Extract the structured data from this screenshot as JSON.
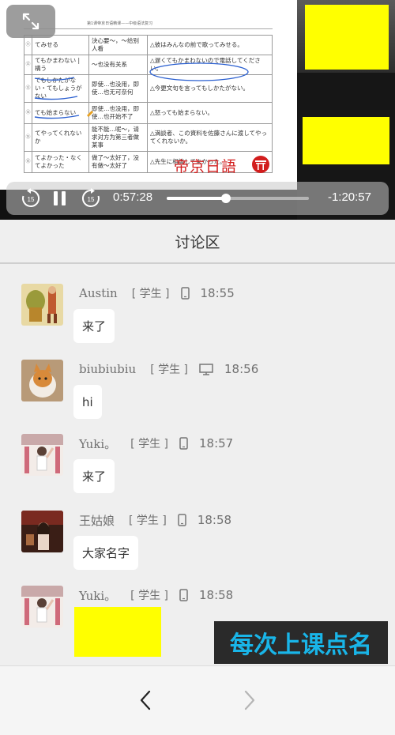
{
  "video": {
    "slide": {
      "header_text": "第1课帝京日语精课——中级语法复习",
      "rows": [
        {
          "num": "⑪",
          "jp": "てみせる",
          "cn": "決心要〜，〜给别人看",
          "ex": "△彼はみんなの前で歌ってみせる。"
        },
        {
          "num": "⑫",
          "jp": "てもかまわない | 構う",
          "cn": "～也没有关系",
          "ex": "△遅くてもかまわないので電話してください。"
        },
        {
          "num": "⑬",
          "jp": "てもしかたがない・てもしょうがない",
          "cn": "即使…也没用，即使…也无可奈何",
          "ex": "△今更文句を言ってもしかたがない。"
        },
        {
          "num": "⑭",
          "jp": "ても始まらない",
          "cn": "即使…也没用，即使…也开始不了",
          "ex": "△怒っても始まらない。"
        },
        {
          "num": "⑮",
          "jp": "てやってくれないか",
          "cn": "能不能…呢～，请求对方为第三者做某事",
          "ex": "△満談者、この資料を佐藤さんに渡してやってくれないか。"
        },
        {
          "num": "⑯",
          "jp": "てよかった・なくてよかった",
          "cn": "做了～太好了，没有做～太好了",
          "ex": "△先生に相談してよかった。"
        }
      ],
      "logo_text": "帝京日語"
    },
    "controls": {
      "current_time": "0:57:28",
      "remaining_time": "-1:20:57",
      "progress": 0.415,
      "skip_back_seconds": "15",
      "skip_forward_seconds": "15"
    }
  },
  "discussion": {
    "title": "讨论区",
    "messages": [
      {
        "user": "Austin",
        "role": "[ 学生 ]",
        "device": "phone-icon",
        "time": "18:55",
        "text": "来了"
      },
      {
        "user": "biubiubiu",
        "role": "[ 学生 ]",
        "device": "desktop-icon",
        "time": "18:56",
        "text": "hi"
      },
      {
        "user": "Yuki。",
        "role": "[ 学生 ]",
        "device": "phone-icon",
        "time": "18:57",
        "text": "来了"
      },
      {
        "user": "王姑娘",
        "role": "[ 学生 ]",
        "device": "phone-icon",
        "time": "18:58",
        "text": "大家名字"
      },
      {
        "user": "Yuki。",
        "role": "[ 学生 ]",
        "device": "phone-icon",
        "time": "18:58",
        "text": ""
      }
    ]
  },
  "overlay": {
    "banner_text": "每次上课点名"
  },
  "colors": {
    "redaction": "#ffff00",
    "banner_text": "#19b5e8",
    "logo_red": "#d21d1d"
  }
}
